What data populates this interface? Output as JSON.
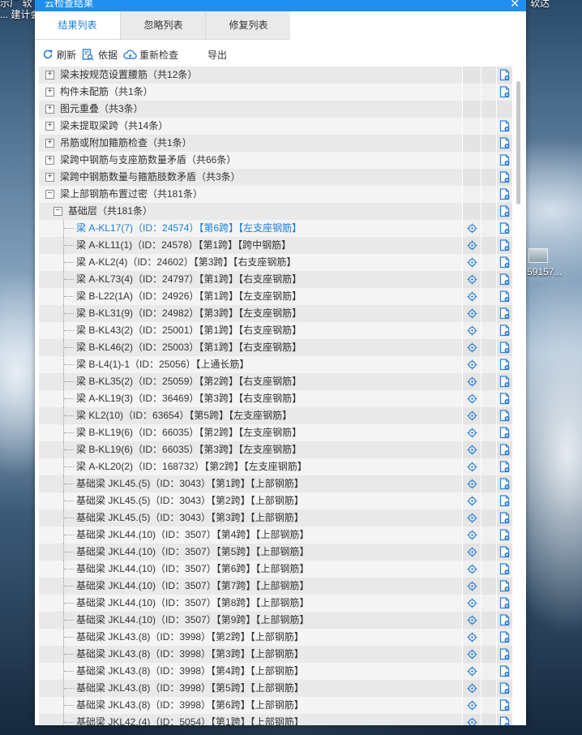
{
  "desktop": {
    "topleft_line1": "示厂 软",
    "topleft_line2": "... 建计会",
    "topright": "软达",
    "right_label": "59157..."
  },
  "dialog": {
    "title": "云检查结果",
    "tabs": [
      {
        "label": "结果列表",
        "active": true
      },
      {
        "label": "忽略列表",
        "active": false
      },
      {
        "label": "修复列表",
        "active": false
      }
    ],
    "toolbar": {
      "refresh": "刷新",
      "basis": "依据",
      "recheck": "重新检查",
      "export": "导出"
    }
  },
  "tree": {
    "rows": [
      {
        "text": "梁未按规范设置腰筋（共12条）",
        "level": 0,
        "expander": "+",
        "loc": false,
        "doc": true
      },
      {
        "text": "构件未配筋（共1条）",
        "level": 0,
        "expander": "+",
        "loc": false,
        "doc": true
      },
      {
        "text": "图元重叠（共3条）",
        "level": 0,
        "expander": "+",
        "loc": false,
        "doc": false
      },
      {
        "text": "梁未提取梁跨（共14条）",
        "level": 0,
        "expander": "+",
        "loc": false,
        "doc": true
      },
      {
        "text": "吊筋或附加箍筋检查（共1条）",
        "level": 0,
        "expander": "+",
        "loc": false,
        "doc": true
      },
      {
        "text": "梁跨中钢筋与支座筋数量矛盾（共66条）",
        "level": 0,
        "expander": "+",
        "loc": false,
        "doc": true
      },
      {
        "text": "梁跨中钢筋数量与箍筋肢数矛盾（共3条）",
        "level": 0,
        "expander": "+",
        "loc": false,
        "doc": true
      },
      {
        "text": "梁上部钢筋布置过密（共181条）",
        "level": 0,
        "expander": "−",
        "loc": false,
        "doc": true
      },
      {
        "text": "基础层（共181条）",
        "level": 1,
        "expander": "−",
        "loc": false,
        "doc": true
      },
      {
        "text": "梁 A-KL17(7)（ID：24574）【第6跨】【左支座钢筋】",
        "level": 2,
        "highlight": true,
        "loc": true,
        "doc": true
      },
      {
        "text": "梁 A-KL11(1)（ID：24578）【第1跨】【跨中钢筋】",
        "level": 2,
        "loc": true,
        "doc": true
      },
      {
        "text": "梁 A-KL2(4)（ID：24602）【第3跨】【右支座钢筋】",
        "level": 2,
        "loc": true,
        "doc": true
      },
      {
        "text": "梁 A-KL73(4)（ID：24797）【第1跨】【右支座钢筋】",
        "level": 2,
        "loc": true,
        "doc": true
      },
      {
        "text": "梁 B-L22(1A)（ID：24926）【第1跨】【左支座钢筋】",
        "level": 2,
        "loc": true,
        "doc": true
      },
      {
        "text": "梁 B-KL31(9)（ID：24982）【第3跨】【左支座钢筋】",
        "level": 2,
        "loc": true,
        "doc": true
      },
      {
        "text": "梁 B-KL43(2)（ID：25001）【第1跨】【右支座钢筋】",
        "level": 2,
        "loc": true,
        "doc": true
      },
      {
        "text": "梁 B-KL46(2)（ID：25003）【第1跨】【右支座钢筋】",
        "level": 2,
        "loc": true,
        "doc": true
      },
      {
        "text": "梁 B-L4(1)-1（ID：25056）【上通长筋】",
        "level": 2,
        "loc": true,
        "doc": true
      },
      {
        "text": "梁 B-KL35(2)（ID：25059）【第2跨】【右支座钢筋】",
        "level": 2,
        "loc": true,
        "doc": true
      },
      {
        "text": "梁 A-KL19(3)（ID：36469）【第3跨】【右支座钢筋】",
        "level": 2,
        "loc": true,
        "doc": true
      },
      {
        "text": "梁 KL2(10)（ID：63654）【第5跨】【左支座钢筋】",
        "level": 2,
        "loc": true,
        "doc": true
      },
      {
        "text": "梁 B-KL19(6)（ID：66035）【第2跨】【左支座钢筋】",
        "level": 2,
        "loc": true,
        "doc": true
      },
      {
        "text": "梁 B-KL19(6)（ID：66035）【第3跨】【左支座钢筋】",
        "level": 2,
        "loc": true,
        "doc": true
      },
      {
        "text": "梁 A-KL20(2)（ID：168732）【第2跨】【左支座钢筋】",
        "level": 2,
        "loc": true,
        "doc": true
      },
      {
        "text": "基础梁 JKL45.(5)（ID：3043）【第1跨】【上部钢筋】",
        "level": 2,
        "loc": true,
        "doc": true
      },
      {
        "text": "基础梁 JKL45.(5)（ID：3043）【第2跨】【上部钢筋】",
        "level": 2,
        "loc": true,
        "doc": true
      },
      {
        "text": "基础梁 JKL45.(5)（ID：3043）【第3跨】【上部钢筋】",
        "level": 2,
        "loc": true,
        "doc": true
      },
      {
        "text": "基础梁 JKL44.(10)（ID：3507）【第4跨】【上部钢筋】",
        "level": 2,
        "loc": true,
        "doc": true
      },
      {
        "text": "基础梁 JKL44.(10)（ID：3507）【第5跨】【上部钢筋】",
        "level": 2,
        "loc": true,
        "doc": true
      },
      {
        "text": "基础梁 JKL44.(10)（ID：3507）【第6跨】【上部钢筋】",
        "level": 2,
        "loc": true,
        "doc": true
      },
      {
        "text": "基础梁 JKL44.(10)（ID：3507）【第7跨】【上部钢筋】",
        "level": 2,
        "loc": true,
        "doc": true
      },
      {
        "text": "基础梁 JKL44.(10)（ID：3507）【第8跨】【上部钢筋】",
        "level": 2,
        "loc": true,
        "doc": true
      },
      {
        "text": "基础梁 JKL44.(10)（ID：3507）【第9跨】【上部钢筋】",
        "level": 2,
        "loc": true,
        "doc": true
      },
      {
        "text": "基础梁 JKL43.(8)（ID：3998）【第2跨】【上部钢筋】",
        "level": 2,
        "loc": true,
        "doc": true
      },
      {
        "text": "基础梁 JKL43.(8)（ID：3998）【第3跨】【上部钢筋】",
        "level": 2,
        "loc": true,
        "doc": true
      },
      {
        "text": "基础梁 JKL43.(8)（ID：3998）【第4跨】【上部钢筋】",
        "level": 2,
        "loc": true,
        "doc": true
      },
      {
        "text": "基础梁 JKL43.(8)（ID：3998）【第5跨】【上部钢筋】",
        "level": 2,
        "loc": true,
        "doc": true
      },
      {
        "text": "基础梁 JKL43.(8)（ID：3998）【第6跨】【上部钢筋】",
        "level": 2,
        "loc": true,
        "doc": true
      },
      {
        "text": "基础梁 JKL42.(4)（ID：5054）【第1跨】【上部钢筋】",
        "level": 2,
        "loc": true,
        "doc": true
      }
    ]
  },
  "colors": {
    "accent": "#1b7fd6",
    "titlebar": "#1f8ff2",
    "icon_blue": "#2f7fd0"
  }
}
